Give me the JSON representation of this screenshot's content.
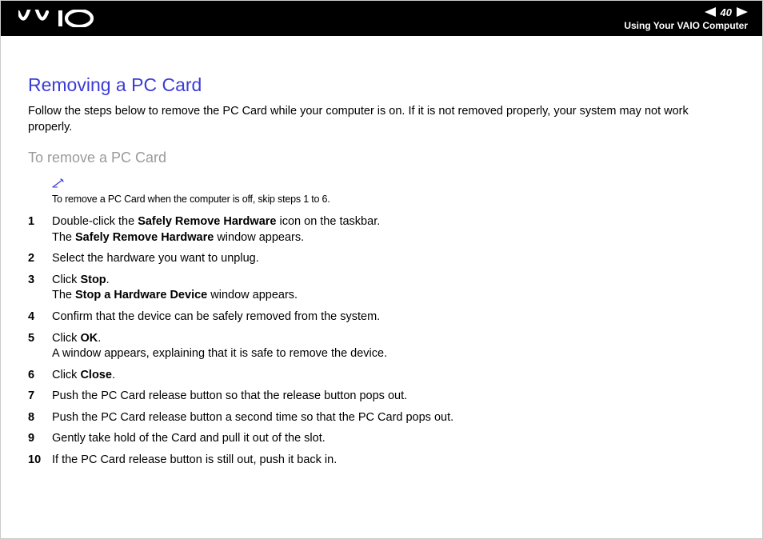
{
  "header": {
    "page_number": "40",
    "section": "Using Your VAIO Computer"
  },
  "content": {
    "heading": "Removing a PC Card",
    "intro": "Follow the steps below to remove the PC Card while your computer is on. If it is not removed properly, your system may not work properly.",
    "sub_heading": "To remove a PC Card",
    "note": "To remove a PC Card when the computer is off, skip steps 1 to 6.",
    "steps": [
      {
        "num": "1",
        "html": "Double-click the <b>Safely Remove Hardware</b> icon on the taskbar.<br>The <b>Safely Remove Hardware</b> window appears."
      },
      {
        "num": "2",
        "html": "Select the hardware you want to unplug."
      },
      {
        "num": "3",
        "html": "Click <b>Stop</b>.<br>The <b>Stop a Hardware Device</b> window appears."
      },
      {
        "num": "4",
        "html": "Confirm that the device can be safely removed from the system."
      },
      {
        "num": "5",
        "html": "Click <b>OK</b>.<br>A window appears, explaining that it is safe to remove the device."
      },
      {
        "num": "6",
        "html": "Click <b>Close</b>."
      },
      {
        "num": "7",
        "html": "Push the PC Card release button so that the release button pops out."
      },
      {
        "num": "8",
        "html": "Push the PC Card release button a second time so that the PC Card pops out."
      },
      {
        "num": "9",
        "html": "Gently take hold of the Card and pull it out of the slot."
      },
      {
        "num": "10",
        "html": "If the PC Card release button is still out, push it back in."
      }
    ]
  }
}
